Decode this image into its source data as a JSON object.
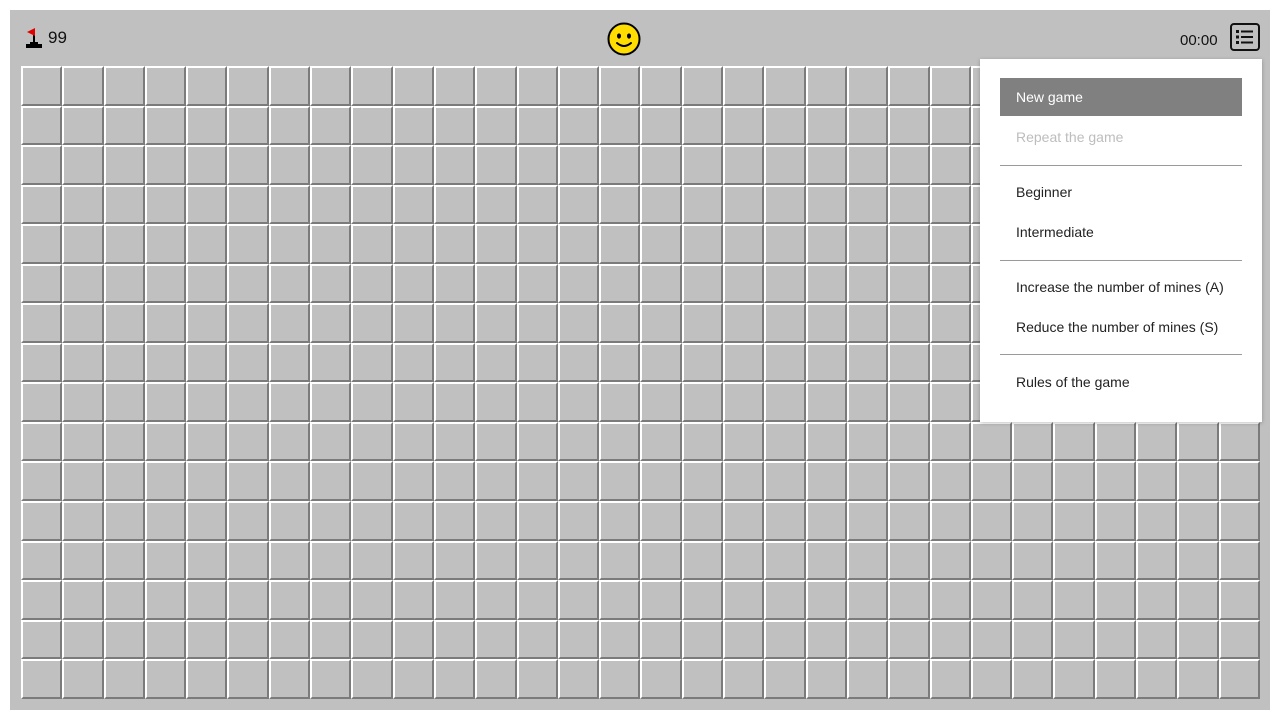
{
  "header": {
    "mine_count": "99",
    "timer": "00:00",
    "flag_icon": "flag-icon",
    "smiley_icon": "smiley-face-icon",
    "menu_icon": "list-menu-icon"
  },
  "board": {
    "columns": 30,
    "rows": 16,
    "cell_state": "unrevealed"
  },
  "menu": {
    "items": [
      {
        "label": "New game",
        "state": "active"
      },
      {
        "label": "Repeat the game",
        "state": "disabled"
      },
      {
        "label": "Beginner",
        "state": "normal"
      },
      {
        "label": "Intermediate",
        "state": "normal"
      },
      {
        "label": "Increase the number of mines (A)",
        "state": "normal"
      },
      {
        "label": "Reduce the number of mines (S)",
        "state": "normal"
      },
      {
        "label": "Rules of the game",
        "state": "normal"
      }
    ]
  },
  "colors": {
    "board_background": "#c0c0c0",
    "flag_red": "#e00000",
    "smiley_yellow": "#ffdd00",
    "menu_active": "#808080"
  }
}
